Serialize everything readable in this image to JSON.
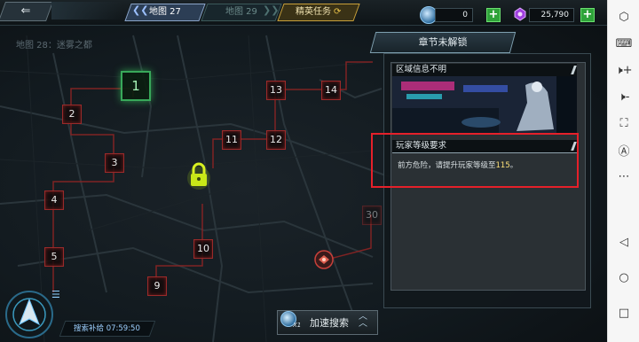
{
  "topbar": {
    "back_label": "⇐",
    "tab_map27": "地图 27",
    "tab_map29": "地图 29",
    "tab_elite": "精英任务",
    "currency1_value": "0",
    "currency2_value": "25,790",
    "plus": "+"
  },
  "map": {
    "title": "地图 28：迷雾之都",
    "nodes": [
      "1",
      "2",
      "3",
      "4",
      "5",
      "9",
      "10",
      "11",
      "12",
      "13",
      "14",
      "30"
    ]
  },
  "panel": {
    "header": "章节未解锁",
    "area_info_title": "区域信息不明",
    "requirement_title": "玩家等级要求",
    "requirement_text_prefix": "前方危险，请提升玩家等级至",
    "requirement_level": "115",
    "requirement_text_suffix": "。"
  },
  "bottom": {
    "search_supply": "搜索补给 07:59:50",
    "accelerate_label": "加速搜索",
    "accelerate_count": "X1"
  },
  "icons": {
    "menu": "list-icon",
    "lock": "lock-icon"
  },
  "colors": {
    "highlight_border": "#e5202a",
    "level_text": "#ffe27a",
    "start_node": "#38a85a"
  }
}
